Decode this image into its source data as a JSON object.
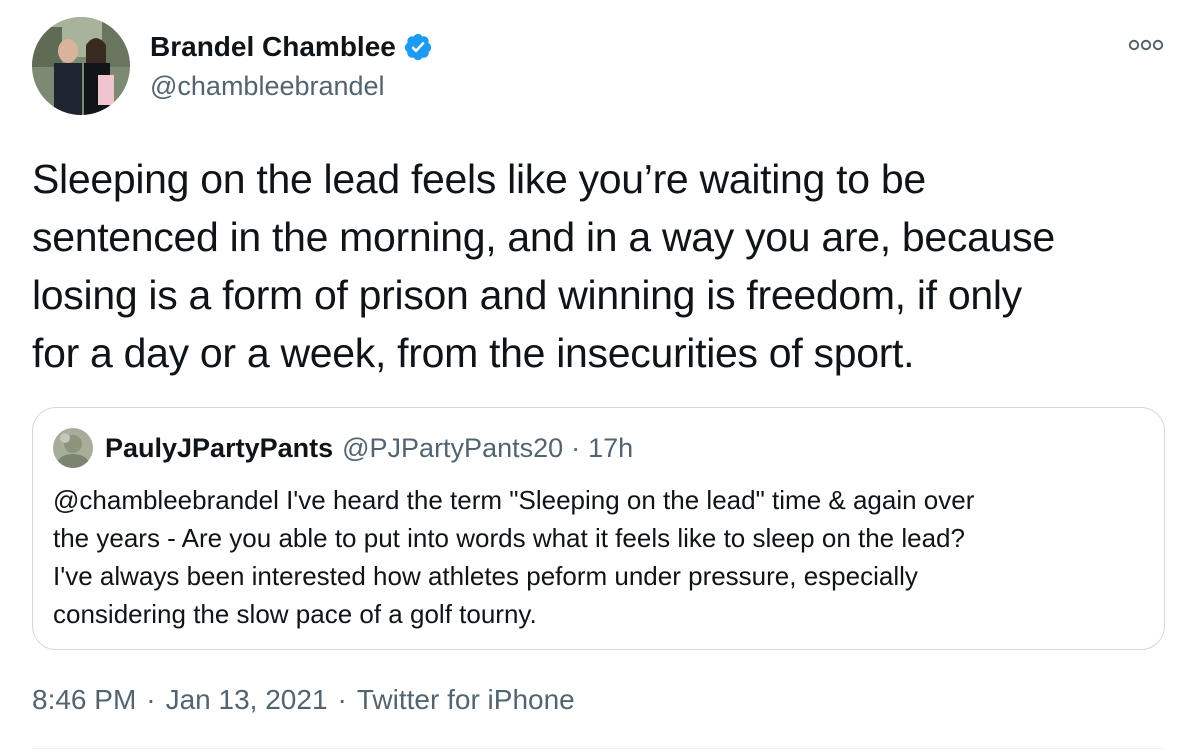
{
  "author": {
    "display_name": "Brandel Chamblee",
    "handle": "@chambleebrandel",
    "verified": true
  },
  "tweet": {
    "text_lines": [
      "Sleeping on the lead feels like you’re waiting to be",
      "sentenced in the morning, and in a way you are, because",
      "losing is a form of prison and winning is freedom, if only",
      "for a day or a week, from the insecurities of sport."
    ]
  },
  "quote": {
    "display_name": "PaulyJPartyPants",
    "handle": "@PJPartyPants20",
    "separator": "·",
    "time": "17h",
    "text_lines": [
      "@chambleebrandel I've heard the term \"Sleeping on the lead\" time & again over",
      "the years - Are you able to put into words what it feels like to sleep on the lead?",
      "I've always been interested how athletes peform under pressure, especially",
      "considering the slow pace of a golf tourny."
    ]
  },
  "meta": {
    "time": "8:46 PM",
    "date": "Jan 13, 2021",
    "source": "Twitter for iPhone",
    "separator": "·"
  },
  "icons": {
    "verified": "verified-badge-icon",
    "more": "more-options-icon"
  },
  "colors": {
    "text_primary": "#0f1419",
    "text_secondary": "#536471",
    "verified_blue": "#1d9bf0",
    "border": "#cfd9de"
  }
}
